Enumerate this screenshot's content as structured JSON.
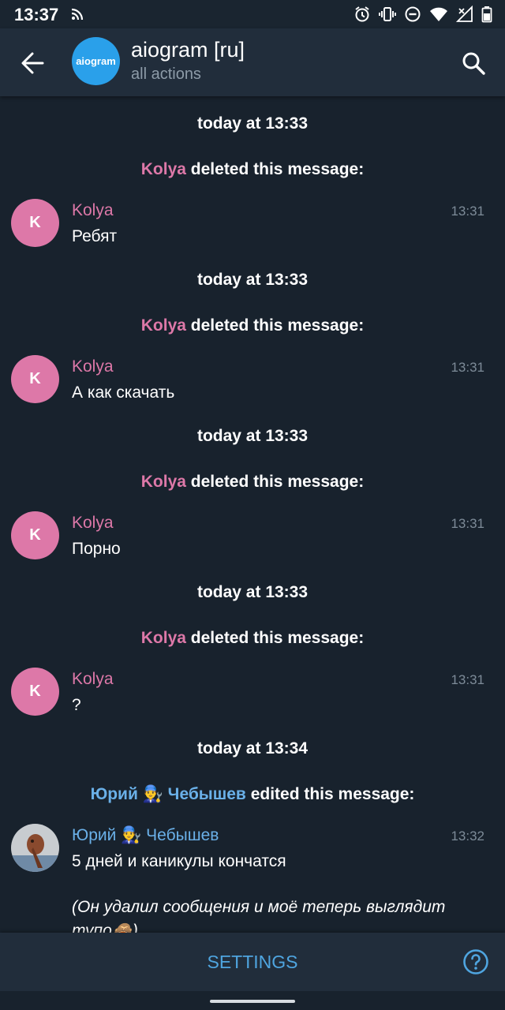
{
  "status_bar": {
    "time": "13:37"
  },
  "header": {
    "title": "aiogram [ru]",
    "subtitle": "all actions",
    "avatar_text": "aiogram"
  },
  "events": [
    {
      "date": "today at 13:33",
      "actor": "Kolya",
      "action": "deleted this message:",
      "author": "Kolya",
      "avatar_letter": "K",
      "time": "13:31",
      "text": "Ребят"
    },
    {
      "date": "today at 13:33",
      "actor": "Kolya",
      "action": "deleted this message:",
      "author": "Kolya",
      "avatar_letter": "K",
      "time": "13:31",
      "text": "А как скачать"
    },
    {
      "date": "today at 13:33",
      "actor": "Kolya",
      "action": "deleted this message:",
      "author": "Kolya",
      "avatar_letter": "K",
      "time": "13:31",
      "text": "Порно"
    },
    {
      "date": "today at 13:33",
      "actor": "Kolya",
      "action": "deleted this message:",
      "author": "Kolya",
      "avatar_letter": "K",
      "time": "13:31",
      "text": "?"
    },
    {
      "date": "today at 13:34",
      "actor": "Юрий 👨‍🔧 Чебышев",
      "action": "edited this message:",
      "author": "Юрий 👨‍🔧 Чебышев",
      "time": "13:32",
      "text": "5 дней и каникулы кончатся",
      "text2": "(Он удалил сообщения и моё теперь выглядит тупо🙈)"
    }
  ],
  "bottom": {
    "settings_label": "SETTINGS"
  },
  "colors": {
    "background": "#18222d",
    "header": "#212d3b",
    "accent": "#4fa5e0",
    "kolya": "#dd78a8",
    "yuri": "#6ab0e8"
  }
}
